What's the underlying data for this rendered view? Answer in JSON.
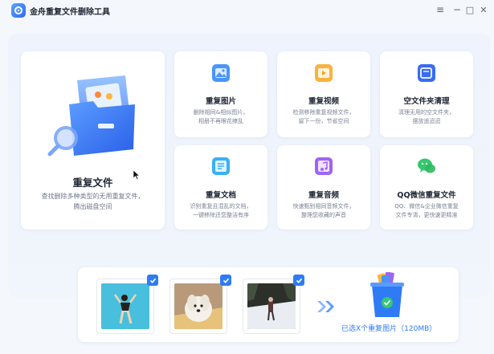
{
  "app": {
    "title": "金舟重复文件删除工具",
    "icon": "app-logo-icon"
  },
  "window_controls": {
    "menu": "≡",
    "minimize": "−",
    "maximize": "□",
    "close": "✕"
  },
  "main_card": {
    "title": "重复文件",
    "desc_line1": "查找删除多种类型的无用重复文件，",
    "desc_line2": "腾出磁盘空间",
    "icon": "folder-search-icon"
  },
  "cards": [
    {
      "title": "重复图片",
      "desc_line1": "删除相同&相似图片，",
      "desc_line2": "相册不再眼花缭乱",
      "icon": "image-icon",
      "color": "#3e8ef7"
    },
    {
      "title": "重复视频",
      "desc_line1": "检测移除重复视频文件，",
      "desc_line2": "留下一份，节省空间",
      "icon": "video-icon",
      "color": "#f5a623"
    },
    {
      "title": "空文件夹清理",
      "desc_line1": "清理无用的空文件夹，",
      "desc_line2": "摆放遥迢迢",
      "icon": "empty-folder-icon",
      "color": "#3a6cf0"
    },
    {
      "title": "重复文档",
      "desc_line1": "识别重复且混乱的文档，",
      "desc_line2": "一键移除还您整洁有序",
      "icon": "document-icon",
      "color": "#2fa6f0"
    },
    {
      "title": "重复音频",
      "desc_line1": "快速甄别相同音频文件，",
      "desc_line2": "整理您收藏的声音",
      "icon": "music-icon",
      "color": "#9b5cf0"
    },
    {
      "title": "QQ微信重复文件",
      "desc_line1": "QQ、微信&企业微信重复",
      "desc_line2": "文件专清，更快速更精准",
      "icon": "wechat-icon",
      "color": "#2cc36b"
    }
  ],
  "bottom": {
    "selected_text": "已选X个重复图片（120MB）",
    "thumbnails": [
      "pool-photo",
      "dog-photo",
      "snow-photo"
    ],
    "arrow_icon": "double-chevron-right-icon",
    "bin_icon": "recycle-bin-icon"
  }
}
